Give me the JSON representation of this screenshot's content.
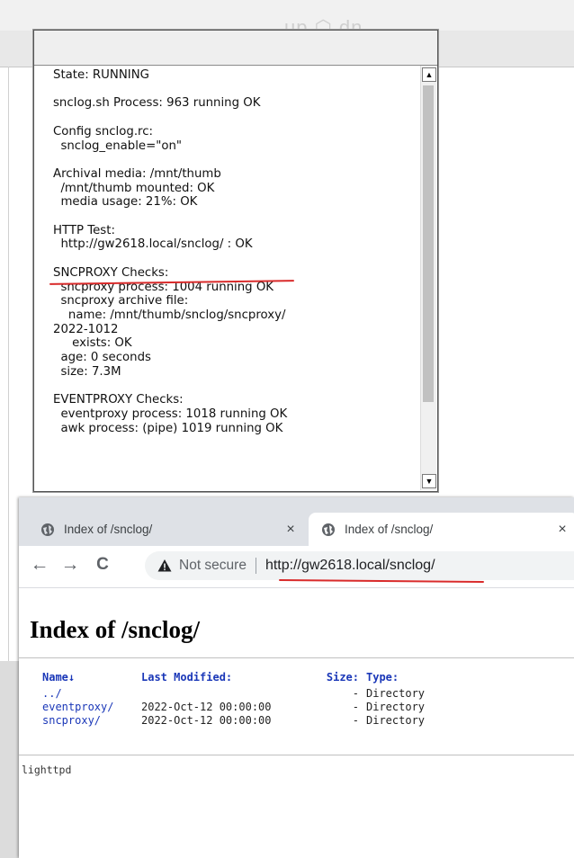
{
  "background": {
    "ghost_title": "up ⬡ dn"
  },
  "status_popup": {
    "lines": [
      "State: RUNNING",
      "",
      "sncIog.sh Process: 963 running OK",
      "",
      "Config snclog.rc:",
      "  snclog_enable=\"on\"",
      "",
      "Archival media: /mnt/thumb",
      "  /mnt/thumb mounted: OK",
      "  media usage: 21%: OK",
      "",
      "HTTP Test:",
      "  http://gw2618.local/snclog/ : OK",
      "",
      "SNCPROXY Checks:",
      "  sncproxy process: 1004 running OK",
      "  sncproxy archive file:",
      "    name: /mnt/thumb/snclog/sncproxy/",
      "2022-1012",
      "     exists: OK",
      "  age: 0 seconds",
      "  size: 7.3M",
      "",
      "EVENTPROXY Checks:",
      "  eventproxy process: 1018 running OK",
      "  awk process: (pipe) 1019 running OK"
    ]
  },
  "browser": {
    "tabs": [
      {
        "title": "Index of /snclog/",
        "close": "×",
        "active": false
      },
      {
        "title": "Index of /snclog/",
        "close": "×",
        "active": true
      }
    ],
    "nav": {
      "back": "←",
      "forward": "→",
      "reload": "C"
    },
    "omnibox": {
      "security": "Not secure",
      "url": "http://gw2618.local/snclog/"
    },
    "page": {
      "heading": "Index of /snclog/",
      "columns": [
        "Name↓",
        "Last Modified:",
        "Size:",
        "Type:"
      ],
      "rows": [
        {
          "name": "../",
          "modified": "",
          "size": "-",
          "type": "Directory"
        },
        {
          "name": "eventproxy/",
          "modified": "2022-Oct-12 00:00:00",
          "size": "-",
          "type": "Directory"
        },
        {
          "name": "sncproxy/",
          "modified": "2022-Oct-12 00:00:00",
          "size": "-",
          "type": "Directory"
        }
      ],
      "server": "lighttpd"
    }
  },
  "colors": {
    "underline": "#d92b2b",
    "link": "#1a37b8",
    "tabbar": "#dee1e6"
  }
}
